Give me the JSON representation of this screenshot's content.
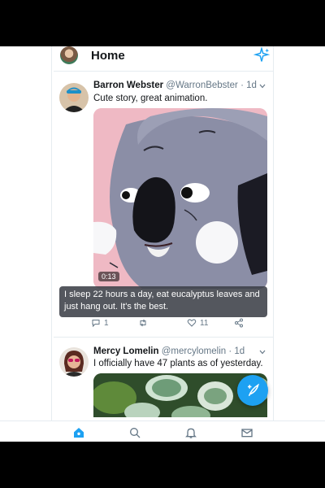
{
  "header": {
    "title": "Home",
    "avatar_icon": "user-avatar",
    "sparkle_icon": "sparkle-icon"
  },
  "tweets": [
    {
      "name": "Barron Webster",
      "handle": "@WarronBebster",
      "time": "· 1d",
      "text": "Cute story, great animation.",
      "media_duration": "0:13",
      "caption": "I sleep 22 hours a day, eat eucalyptus leaves and just hang out. It's the best.",
      "replies": "1",
      "retweets": "",
      "likes": "11"
    },
    {
      "name": "Mercy Lomelin",
      "handle": "@mercylomelin",
      "time": "· 1d",
      "text": "I officially have 47 plants as of yesterday."
    }
  ],
  "tabs": [
    "home-icon",
    "search-icon",
    "bell-icon",
    "mail-icon"
  ],
  "colors": {
    "accent": "#1da1f2",
    "koala_bg": "#efb9c4",
    "koala_body": "#8b8ea6"
  }
}
